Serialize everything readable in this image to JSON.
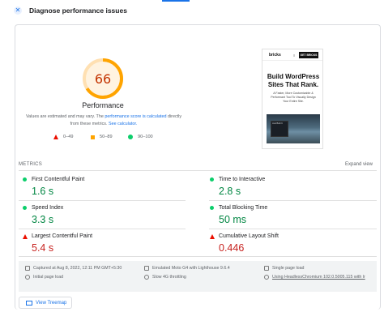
{
  "header": {
    "title": "Diagnose performance issues",
    "icon": "diagnose-icon"
  },
  "gauge": {
    "score": "66",
    "score_value": 66,
    "label": "Performance",
    "color": "#ffa400",
    "note_prefix": "Values are estimated and may vary. The ",
    "note_link1": "performance score is calculated",
    "note_middle": " directly from these metrics. ",
    "note_link2": "See calculator."
  },
  "legend": [
    {
      "range": "0–49",
      "shape": "triangle",
      "color": "#eb0f00"
    },
    {
      "range": "50–89",
      "shape": "square",
      "color": "#ffa400"
    },
    {
      "range": "90–100",
      "shape": "circle",
      "color": "#0cce6b"
    }
  ],
  "screenshot": {
    "brand": "bricks",
    "menu": "≡",
    "button": "GET BRICKS",
    "headline": "Build WordPress Sites That Rank.",
    "subtext": "A Faster, More Customizable & Performant Tool To Visually Design Your Entire Site.",
    "panel_text": "Just Built It"
  },
  "metrics": {
    "title": "METRICS",
    "expand": "Expand view",
    "items": [
      {
        "label": "First Contentful Paint",
        "value": "1.6 s",
        "status": "good"
      },
      {
        "label": "Time to Interactive",
        "value": "2.8 s",
        "status": "good"
      },
      {
        "label": "Speed Index",
        "value": "3.3 s",
        "status": "good"
      },
      {
        "label": "Total Blocking Time",
        "value": "50 ms",
        "status": "good"
      },
      {
        "label": "Largest Contentful Paint",
        "value": "5.4 s",
        "status": "bad"
      },
      {
        "label": "Cumulative Layout Shift",
        "value": "0.446",
        "status": "bad"
      }
    ]
  },
  "info": {
    "captured": "Captured at Aug 8, 2022, 12:11 PM GMT+5:30",
    "initial_load": "Initial page load",
    "emulated": "Emulated Moto G4 with Lighthouse 9.6.4",
    "throttling": "Slow 4G throttling",
    "single_load": "Single page load",
    "headless": "Using HeadlessChromium 102.0.5005.115 with lr"
  },
  "treemap": {
    "label": "View Treemap"
  }
}
